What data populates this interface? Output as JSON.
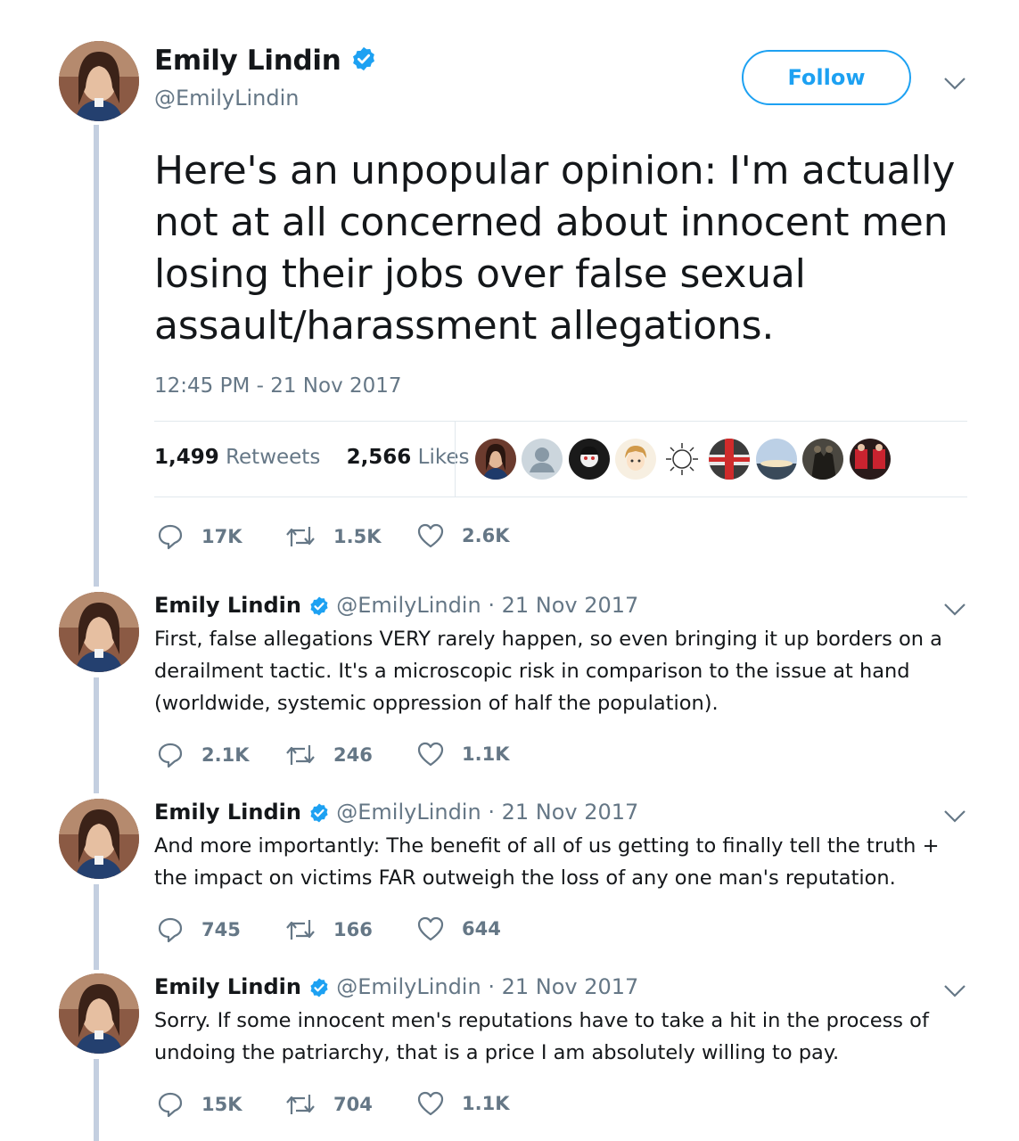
{
  "main_tweet": {
    "name": "Emily Lindin",
    "handle": "@EmilyLindin",
    "follow_label": "Follow",
    "text": "Here's an unpopular opinion: I'm actually not at all concerned about innocent men losing their jobs over false sexual assault/harassment allegations.",
    "timestamp": "12:45 PM - 21 Nov 2017",
    "retweets_count": "1,499",
    "retweets_label": "Retweets",
    "likes_count": "2,566",
    "likes_label": "Likes",
    "actions": {
      "replies": "17K",
      "retweets": "1.5K",
      "likes": "2.6K"
    }
  },
  "replies": [
    {
      "name": "Emily Lindin",
      "handle": "@EmilyLindin",
      "date": " · 21 Nov 2017",
      "text": "First, false allegations VERY rarely happen, so even bringing it up borders on a derailment tactic. It's a microscopic risk in comparison to the issue at hand (worldwide, systemic oppression of half the population).",
      "actions": {
        "replies": "2.1K",
        "retweets": "246",
        "likes": "1.1K"
      }
    },
    {
      "name": "Emily Lindin",
      "handle": "@EmilyLindin",
      "date": " · 21 Nov 2017",
      "text": "And more importantly: The benefit of all of us getting to finally tell the truth + the impact on victims FAR outweigh the loss of any one man's reputation.",
      "actions": {
        "replies": "745",
        "retweets": "166",
        "likes": "644"
      }
    },
    {
      "name": "Emily Lindin",
      "handle": "@EmilyLindin",
      "date": " · 21 Nov 2017",
      "text": "Sorry. If some innocent men's reputations have to take a hit in the process of undoing the patriarchy, that is a price I am absolutely willing to pay.",
      "actions": {
        "replies": "15K",
        "retweets": "704",
        "likes": "1.1K"
      }
    }
  ],
  "colors": {
    "brand_blue": "#1da1f2",
    "muted_text": "#657786",
    "thread_line": "#c4cfe0",
    "divider": "#e1e8ed"
  },
  "icons": [
    "verified-badge-icon",
    "chevron-down-icon",
    "reply-icon",
    "retweet-icon",
    "like-icon"
  ]
}
